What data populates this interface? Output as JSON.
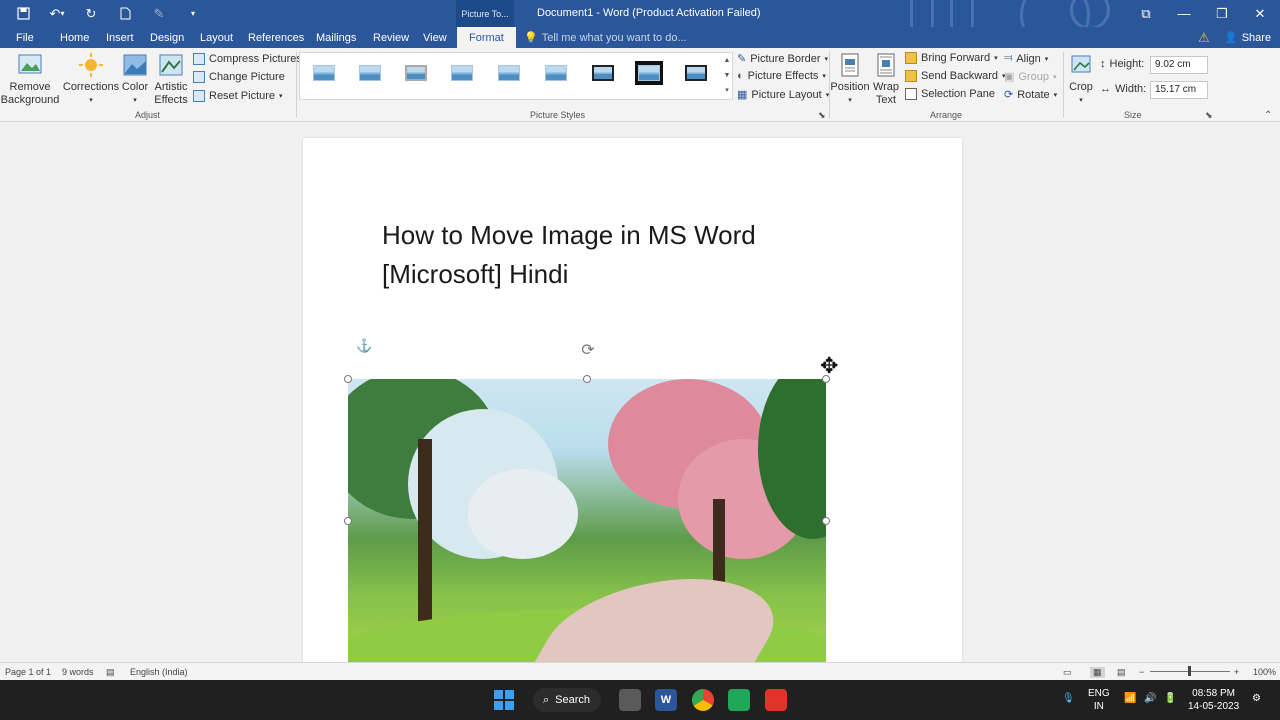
{
  "titlebar": {
    "context_tab": "Picture To...",
    "title": "Document1 - Word (Product Activation Failed)"
  },
  "tabs": [
    "File",
    "Home",
    "Insert",
    "Design",
    "Layout",
    "References",
    "Mailings",
    "Review",
    "View",
    "Format"
  ],
  "tell_me": "Tell me what you want to do...",
  "share": "Share",
  "ribbon": {
    "adjust": {
      "remove_background": [
        "Remove",
        "Background"
      ],
      "corrections": "Corrections",
      "color": "Color",
      "artistic_effects": [
        "Artistic",
        "Effects"
      ],
      "compress": "Compress Pictures",
      "change": "Change Picture",
      "reset": "Reset Picture",
      "label": "Adjust"
    },
    "styles": {
      "label": "Picture Styles",
      "picture_border": "Picture Border",
      "picture_effects": "Picture Effects",
      "picture_layout": "Picture Layout"
    },
    "arrange": {
      "position": "Position",
      "wrap_text": [
        "Wrap",
        "Text"
      ],
      "bring_forward": "Bring Forward",
      "send_backward": "Send Backward",
      "selection_pane": "Selection Pane",
      "align": "Align",
      "group": "Group",
      "rotate": "Rotate",
      "label": "Arrange"
    },
    "size": {
      "crop": "Crop",
      "height_label": "Height:",
      "height_value": "9.02 cm",
      "width_label": "Width:",
      "width_value": "15.17 cm",
      "label": "Size"
    }
  },
  "document": {
    "heading_line1": "How to Move Image in MS Word",
    "heading_line2": "[Microsoft] Hindi"
  },
  "status": {
    "page": "Page 1 of 1",
    "words": "9 words",
    "language": "English (India)",
    "zoom": "100%"
  },
  "taskbar": {
    "search": "Search",
    "lang1": "ENG",
    "lang2": "IN",
    "time": "08:58 PM",
    "date": "14-05-2023"
  },
  "colors": {
    "word_blue": "#2b579a",
    "taskbar": "#202020"
  }
}
